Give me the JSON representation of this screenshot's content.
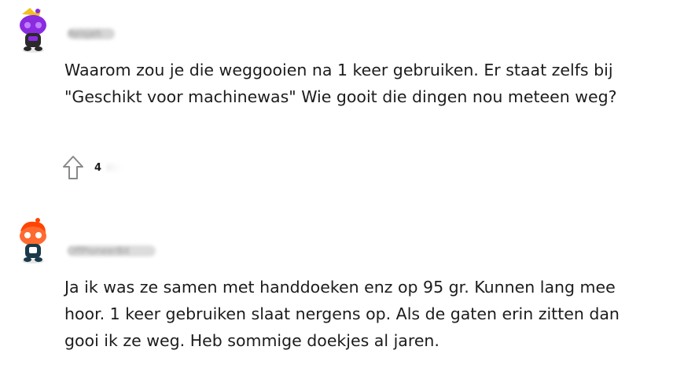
{
  "comments": [
    {
      "username": "Reisjeh",
      "avatar_colors": {
        "primary": "#8a2be2",
        "accent": "#f0c020",
        "dark": "#2a2a2a"
      },
      "body": "Waarom zou je die weggooien na 1 keer gebruiken. Er staat zelfs bij \"Geschikt voor machinewas\" Wie gooit die dingen nou meteen weg?",
      "vote_icon": "upvote-arrow-icon",
      "votes": "4"
    },
    {
      "username": "OffPioneerBit",
      "avatar_colors": {
        "primary": "#ff4500",
        "accent": "#ffffff",
        "dark": "#1a3a4a"
      },
      "body": "Ja ik was ze samen met handdoeken enz op 95 gr. Kunnen lang mee hoor. 1 keer gebruiken slaat nergens op. Als de gaten erin zitten dan gooi ik ze weg. Heb sommige doekjes al jaren."
    }
  ]
}
